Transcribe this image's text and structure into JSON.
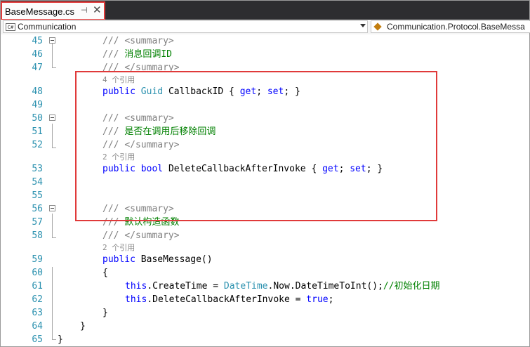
{
  "tab": {
    "title": "BaseMessage.cs",
    "pin_glyph": "⊣",
    "close_glyph": "✕"
  },
  "navbar": {
    "left_icon": "C#",
    "left_label": "Communication",
    "right_label": "Communication.Protocol.BaseMessa"
  },
  "colors": {
    "line_number": "#2b91af",
    "comment": "#008000",
    "keyword": "#0000ff",
    "highlight": "#e03a3a"
  },
  "editor": {
    "lines": [
      {
        "num": "45",
        "prefix": "/// ",
        "text": "<summary>"
      },
      {
        "num": "46",
        "prefix": "/// ",
        "text": "消息回调ID"
      },
      {
        "num": "47",
        "prefix": "/// ",
        "text": "</summary>"
      },
      {
        "refs": "4 个引用"
      },
      {
        "num": "48",
        "kw1": "public",
        "type": "Guid",
        "name": "CallbackID",
        "accessors": [
          "{",
          "get",
          ";",
          "set",
          ";",
          "}"
        ]
      },
      {
        "num": "49"
      },
      {
        "num": "50",
        "prefix": "/// ",
        "text": "<summary>"
      },
      {
        "num": "51",
        "prefix": "/// ",
        "text": "是否在调用后移除回调"
      },
      {
        "num": "52",
        "prefix": "/// ",
        "text": "</summary>"
      },
      {
        "refs": "2 个引用"
      },
      {
        "num": "53",
        "kw1": "public",
        "type": "bool",
        "name": "DeleteCallbackAfterInvoke",
        "accessors": [
          "{",
          "get",
          ";",
          "set",
          ";",
          "}"
        ]
      },
      {
        "num": "54"
      },
      {
        "num": "55"
      },
      {
        "num": "56",
        "prefix": "/// ",
        "text": "<summary>"
      },
      {
        "num": "57",
        "prefix": "/// ",
        "text": "默认构造函数"
      },
      {
        "num": "58",
        "prefix": "/// ",
        "text": "</summary>"
      },
      {
        "refs": "2 个引用"
      },
      {
        "num": "59",
        "kw1": "public",
        "name": "BaseMessage()"
      },
      {
        "num": "60",
        "brace": "{"
      },
      {
        "num": "61",
        "this": "this",
        "member": ".CreateTime = ",
        "type": "DateTime",
        "rest": ".Now.DateTimeToInt();",
        "comment": "//初始化日期"
      },
      {
        "num": "62",
        "this": "this",
        "member": ".DeleteCallbackAfterInvoke = ",
        "value": "true",
        "end": ";"
      },
      {
        "num": "63",
        "brace": "}"
      },
      {
        "num": "64",
        "brace": "}"
      },
      {
        "num": "65",
        "brace": "}"
      }
    ]
  }
}
